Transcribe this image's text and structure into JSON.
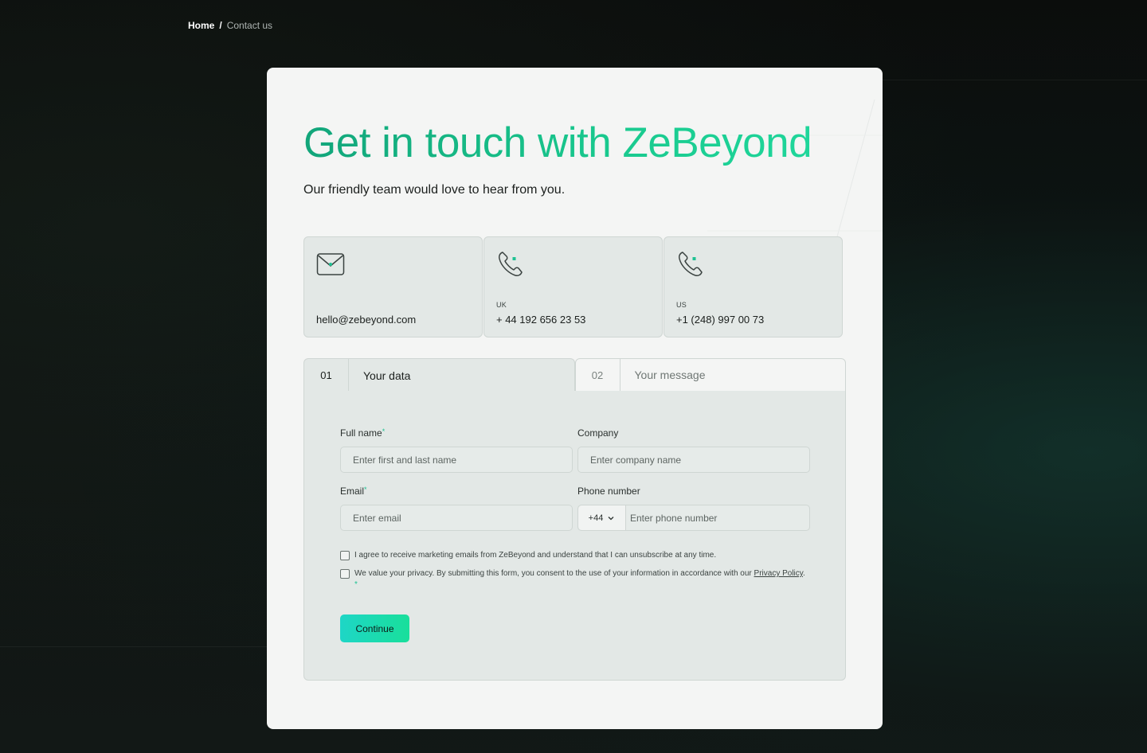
{
  "breadcrumb": {
    "home": "Home",
    "separator": "/",
    "current": "Contact us"
  },
  "header": {
    "title": "Get in touch with ZeBeyond",
    "subtitle": "Our friendly team would love to hear from you."
  },
  "contacts": [
    {
      "icon": "envelope-icon",
      "region": "",
      "value": "hello@zebeyond.com"
    },
    {
      "icon": "phone-icon",
      "region": "UK",
      "value": "+ 44 192 656 23 53"
    },
    {
      "icon": "phone-icon",
      "region": "US",
      "value": "+1 (248) 997 00 73"
    }
  ],
  "steps": [
    {
      "number": "01",
      "label": "Your data",
      "active": true
    },
    {
      "number": "02",
      "label": "Your message",
      "active": false
    }
  ],
  "form": {
    "full_name": {
      "label": "Full name",
      "required": "*",
      "placeholder": "Enter first and last name",
      "value": ""
    },
    "company": {
      "label": "Company",
      "placeholder": "Enter company name",
      "value": ""
    },
    "email": {
      "label": "Email",
      "required": "*",
      "placeholder": "Enter email",
      "value": ""
    },
    "phone": {
      "label": "Phone number",
      "country_code": "+44",
      "placeholder": "Enter phone number",
      "value": ""
    },
    "consent_marketing": "I agree to receive marketing emails from ZeBeyond and understand that I can unsubscribe at any time.",
    "consent_privacy_text": "We value your privacy. By submitting this form, you consent to the use of your information in accordance with our",
    "privacy_link": "Privacy Policy",
    "privacy_suffix": ".",
    "privacy_required": "*",
    "continue_label": "Continue"
  },
  "colors": {
    "accent_start": "#12a57a",
    "accent_end": "#1fd69a",
    "button_start": "#1ed6c6",
    "button_end": "#19df9b"
  }
}
